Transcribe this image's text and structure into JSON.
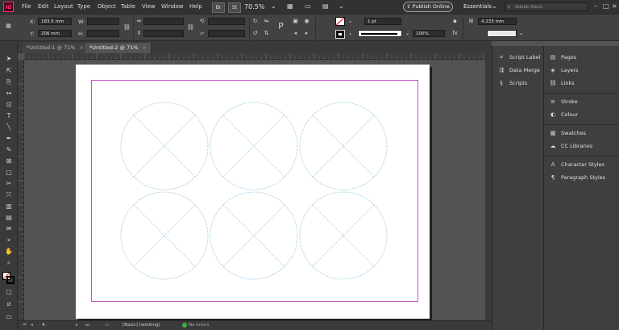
{
  "app": {
    "logo_text": "Id",
    "menu": [
      "File",
      "Edit",
      "Layout",
      "Type",
      "Object",
      "Table",
      "View",
      "Window",
      "Help"
    ],
    "bridge_label": "Br",
    "stock_label": "St",
    "zoom": "70.5%",
    "publish_label": "Publish Online",
    "workspace": "Essentials",
    "search_placeholder": "Adobe Stock"
  },
  "control_bar": {
    "x_label": "X:",
    "x_value": "183.5 mm",
    "y_label": "Y:",
    "y_value": "206 mm",
    "w_label": "W:",
    "h_label": "H:",
    "stroke_weight": "1 pt",
    "opacity": "100%",
    "gap_value": "4.233 mm"
  },
  "tabs": [
    {
      "label": "*Untitled-1 @ 71%",
      "close": "×",
      "active": false
    },
    {
      "label": "*Untitled-2 @ 71%",
      "close": "×",
      "active": true
    }
  ],
  "status": {
    "page_number": "4",
    "master": "[Basic] (working)",
    "errors": "No errors"
  },
  "panels": {
    "col1": [
      {
        "label": "Script Label",
        "icon": "tag-icon"
      },
      {
        "label": "Data Merge",
        "icon": "data-merge-icon"
      },
      {
        "label": "Scripts",
        "icon": "scripts-icon"
      }
    ],
    "col2": [
      {
        "label": "Pages",
        "icon": "pages-icon"
      },
      {
        "label": "Layers",
        "icon": "layers-icon"
      },
      {
        "label": "Links",
        "icon": "links-icon"
      },
      {
        "label": "Stroke",
        "icon": "stroke-icon"
      },
      {
        "label": "Colour",
        "icon": "colour-icon"
      },
      {
        "label": "Swatches",
        "icon": "swatches-icon"
      },
      {
        "label": "CC Libraries",
        "icon": "cc-libraries-icon"
      },
      {
        "label": "Character Styles",
        "icon": "character-styles-icon"
      },
      {
        "label": "Paragraph Styles",
        "icon": "paragraph-styles-icon"
      }
    ]
  },
  "colors": {
    "accent_magenta": "#c64fc9",
    "frame_cyan": "#7fb3c7",
    "no_errors_green": "#3fae3f"
  }
}
